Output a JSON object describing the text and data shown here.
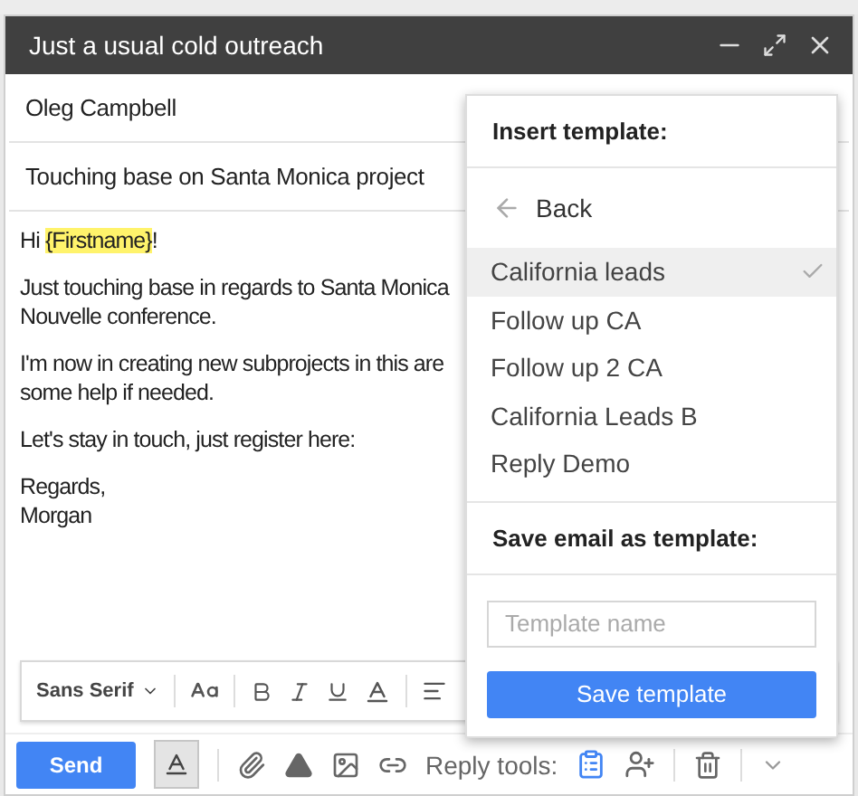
{
  "window": {
    "title": "Just a usual cold outreach"
  },
  "to": "Oleg Campbell",
  "subject": "Touching base on Santa Monica project",
  "body": {
    "greeting": {
      "before": "Hi ",
      "highlight": "{Firstname}",
      "after": "!"
    },
    "paragraphs": [
      [
        "Just touching base in regards to Santa Monica",
        "Nouvelle conference."
      ],
      [
        "I'm now in creating new subprojects in this are",
        "some help if needed."
      ],
      [
        "Let's stay in touch, just register here:"
      ],
      [
        "Regards,",
        "Morgan"
      ]
    ]
  },
  "template_menu": {
    "insert_title": "Insert template:",
    "back": "Back",
    "templates": [
      {
        "label": "California leads",
        "selected": true
      },
      {
        "label": "Follow up CA",
        "selected": false
      },
      {
        "label": "Follow up 2 CA",
        "selected": false
      },
      {
        "label": "California Leads B",
        "selected": false
      },
      {
        "label": "Reply Demo",
        "selected": false
      }
    ],
    "save_title": "Save email as template:",
    "name_field": {
      "placeholder": "Template name"
    },
    "save_button": "Save template"
  },
  "format_bar": {
    "font": "Sans Serif"
  },
  "bottom_bar": {
    "send": "Send",
    "formatting_on": true,
    "reply_tools_label": "Reply tools:"
  }
}
